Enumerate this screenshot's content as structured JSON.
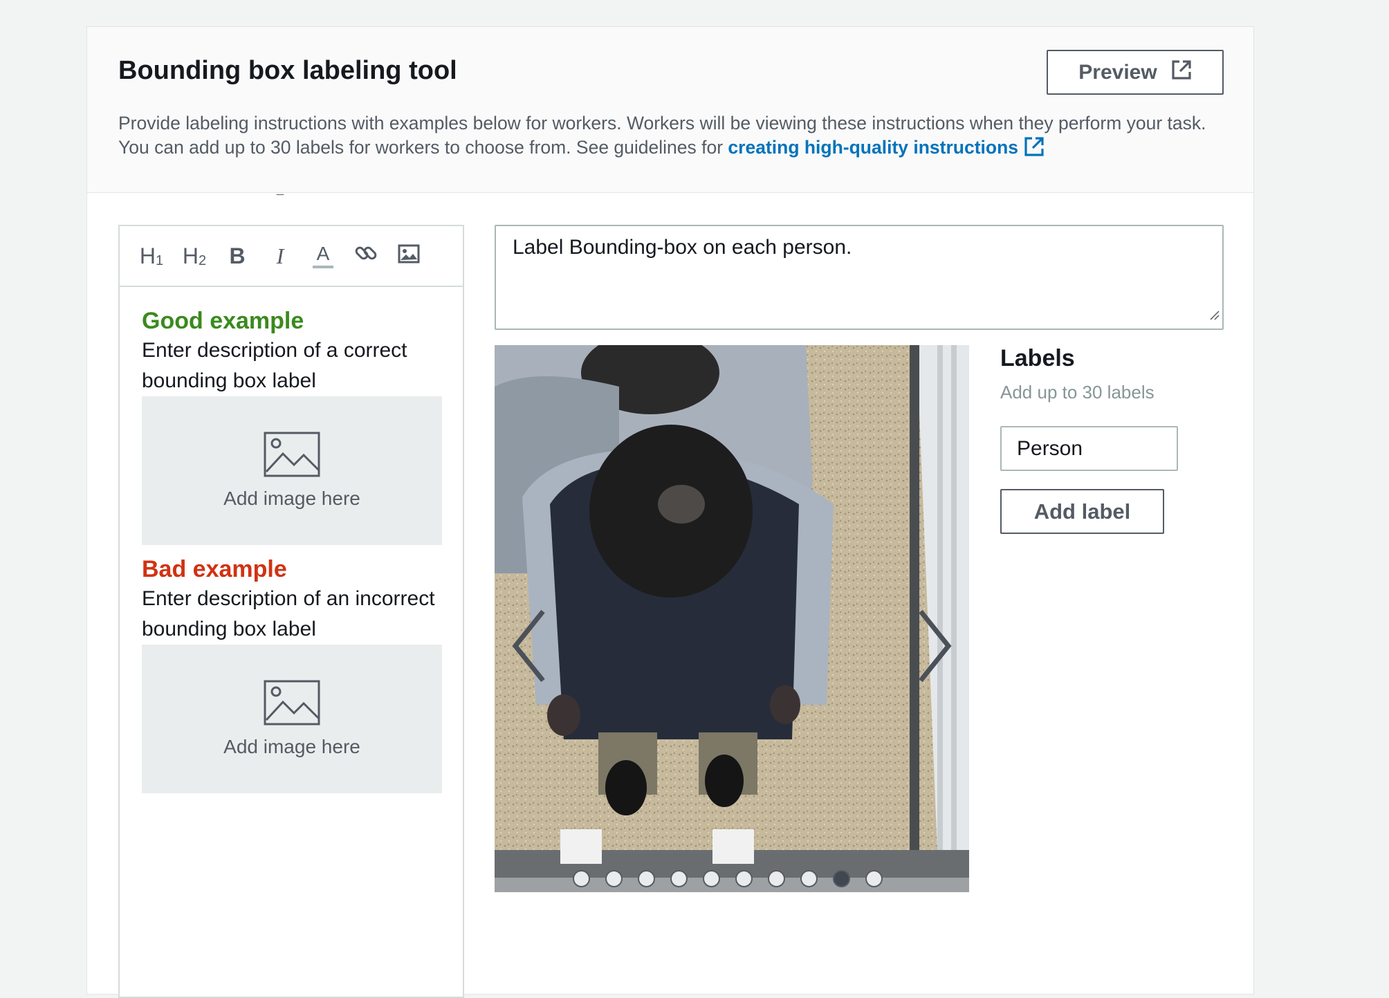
{
  "header": {
    "title": "Bounding box labeling tool",
    "preview_label": "Preview",
    "description_text": "Provide labeling instructions with examples below for workers. Workers will be viewing these instructions when they perform your task. You can add up to 30 labels for workers to choose from. See guidelines for ",
    "link_text": "creating high-quality instructions"
  },
  "toolbar": {
    "h1": "H",
    "h1_sub": "1",
    "h2": "H",
    "h2_sub": "2",
    "bold": "B",
    "italic": "I",
    "font_color": "A",
    "icons": [
      "heading-1-icon",
      "heading-2-icon",
      "bold-icon",
      "italic-icon",
      "font-color-icon",
      "link-icon",
      "image-icon"
    ]
  },
  "editor": {
    "good": {
      "heading": "Good example",
      "description": "Enter description of a correct bounding box label",
      "placeholder": "Add image here"
    },
    "bad": {
      "heading": "Bad example",
      "description": "Enter description of an incorrect bounding box label",
      "placeholder": "Add image here"
    },
    "colors": {
      "good": "#3a8a1d",
      "bad": "#d13212"
    }
  },
  "instruction": {
    "text": "Label Bounding-box on each person."
  },
  "carousel": {
    "slide_count": 10,
    "active_index": 8
  },
  "labels": {
    "title": "Labels",
    "subtitle": "Add up to 30 labels",
    "input_value": "Person",
    "add_button": "Add label"
  },
  "colors": {
    "accent_link": "#0073bb",
    "button_border": "#545b64"
  }
}
